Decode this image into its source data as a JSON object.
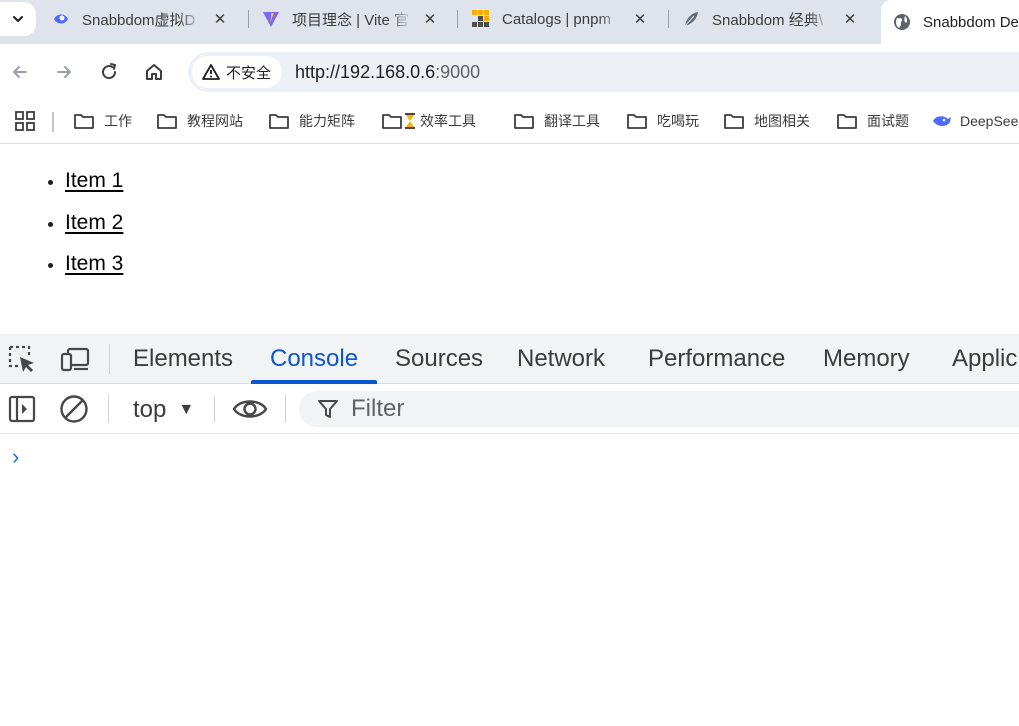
{
  "tabs": [
    {
      "title": "Snabbdom虚拟D",
      "favicon": "eye-icon"
    },
    {
      "title": "项目理念 | Vite 官",
      "favicon": "vite-icon"
    },
    {
      "title": "Catalogs | pnpm",
      "favicon": "pnpm-icon"
    },
    {
      "title": "Snabbdom 经典\\",
      "favicon": "feather-icon"
    },
    {
      "title": "Snabbdom De",
      "favicon": "globe-icon",
      "active": true
    }
  ],
  "toolbar": {
    "security_label": "不安全",
    "url_host": "http://192.168.0.6",
    "url_port": ":9000"
  },
  "bookmarks": [
    {
      "label": "工作",
      "icon": "folder-icon"
    },
    {
      "label": "教程网站",
      "icon": "folder-icon"
    },
    {
      "label": "能力矩阵",
      "icon": "folder-icon"
    },
    {
      "label": "效率工具",
      "icon": "folder-icon"
    },
    {
      "label": "翻译工具",
      "icon": "folder-icon"
    },
    {
      "label": "吃喝玩",
      "icon": "folder-icon"
    },
    {
      "label": "地图相关",
      "icon": "folder-icon"
    },
    {
      "label": "面试题",
      "icon": "folder-icon"
    },
    {
      "label": "DeepSee",
      "icon": "deepseek-icon"
    }
  ],
  "page": {
    "items": [
      "Item 1",
      "Item 2",
      "Item 3"
    ]
  },
  "devtools": {
    "tabs": [
      "Elements",
      "Console",
      "Sources",
      "Network",
      "Performance",
      "Memory",
      "Applic"
    ],
    "active_tab": "Console",
    "context": "top",
    "filter_placeholder": "Filter",
    "prompt_symbol": "›"
  },
  "colors": {
    "accent": "#0b57d0",
    "tabstrip_bg": "#dfe3eb",
    "prompt": "#1a73e8"
  }
}
